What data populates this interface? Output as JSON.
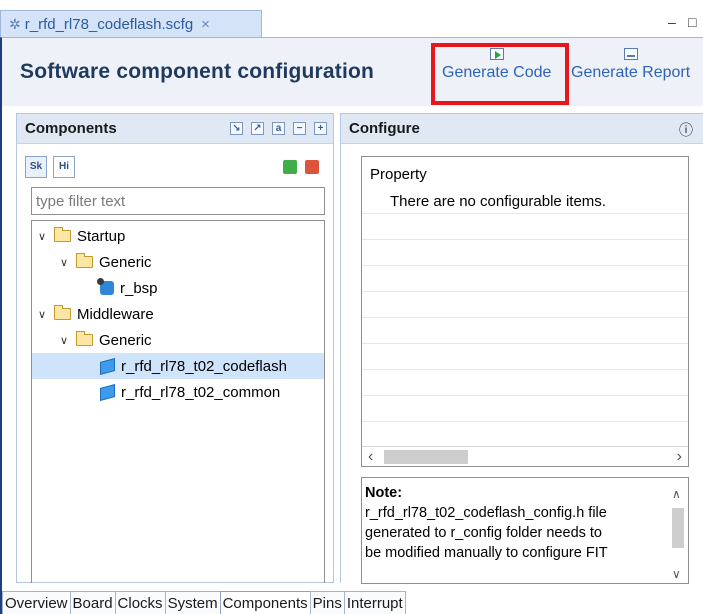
{
  "editor_tab": {
    "title": "r_rfd_rl78_codeflash.scfg",
    "close_glyph": "×"
  },
  "window_controls": {
    "minimize": "‒",
    "maximize": "□"
  },
  "header": {
    "title": "Software component configuration",
    "buttons": [
      {
        "label": "Generate Code",
        "icon": "generate-code-icon"
      },
      {
        "label": "Generate Report",
        "icon": "generate-report-icon"
      }
    ],
    "highlight_color": "#e8161b"
  },
  "components_panel": {
    "title": "Components",
    "toolbar_icons": [
      "import-icon",
      "export-icon",
      "sort-alpha-icon",
      "collapse-all-icon",
      "expand-all-icon"
    ],
    "view_toggles": [
      "Sk",
      "Hi"
    ],
    "filter_placeholder": "type filter text",
    "tree": [
      {
        "label": "Startup",
        "level": 0,
        "type": "folder",
        "expanded": true
      },
      {
        "label": "Generic",
        "level": 1,
        "type": "folder",
        "expanded": true
      },
      {
        "label": "r_bsp",
        "level": 2,
        "type": "bsp"
      },
      {
        "label": "Middleware",
        "level": 0,
        "type": "folder",
        "expanded": true
      },
      {
        "label": "Generic",
        "level": 1,
        "type": "folder",
        "expanded": true
      },
      {
        "label": "r_rfd_rl78_t02_codeflash",
        "level": 2,
        "type": "component",
        "selected": true
      },
      {
        "label": "r_rfd_rl78_t02_common",
        "level": 2,
        "type": "component"
      }
    ]
  },
  "configure_panel": {
    "title": "Configure",
    "info_glyph": "ⓘ",
    "property_column": "Property",
    "empty_message": "There are no configurable items.",
    "note_title": "Note:",
    "note_lines": [
      "r_rfd_rl78_t02_codeflash_config.h file",
      "generated to r_config folder needs to",
      "be modified manually to configure FIT"
    ]
  },
  "bottom_tabs": [
    "Overview",
    "Board",
    "Clocks",
    "System",
    "Components",
    "Pins",
    "Interrupt"
  ],
  "active_bottom_tab": "Components"
}
